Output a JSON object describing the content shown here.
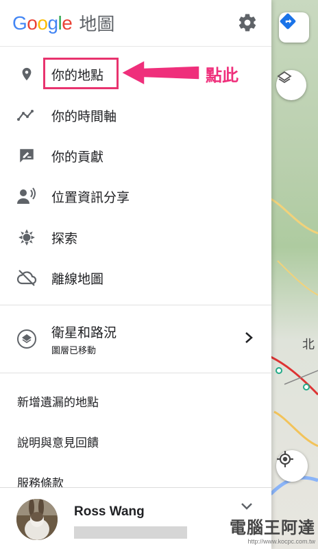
{
  "header": {
    "brand_letters": [
      "G",
      "o",
      "o",
      "g",
      "l",
      "e"
    ],
    "brand_colors": [
      "#4285F4",
      "#EA4335",
      "#FBBC05",
      "#4285F4",
      "#34A853",
      "#EA4335"
    ],
    "suffix": "地圖"
  },
  "menu": [
    {
      "label": "你的地點",
      "icon": "location-pin-icon"
    },
    {
      "label": "你的時間軸",
      "icon": "timeline-icon"
    },
    {
      "label": "你的貢獻",
      "icon": "contribution-icon"
    },
    {
      "label": "位置資訊分享",
      "icon": "location-sharing-icon"
    },
    {
      "label": "探索",
      "icon": "explore-icon"
    },
    {
      "label": "離線地圖",
      "icon": "offline-cloud-icon"
    }
  ],
  "satellite": {
    "title": "衛星和路況",
    "subtitle": "圖層已移動"
  },
  "links": [
    "新增遺漏的地點",
    "說明與意見回饋",
    "服務條款"
  ],
  "account": {
    "name": "Ross Wang"
  },
  "annotation": {
    "text": "點此",
    "color": "#ef2f7b"
  },
  "map": {
    "label": "北"
  },
  "watermark": {
    "text": "電腦王阿達",
    "url": "http://www.kocpc.com.tw"
  }
}
